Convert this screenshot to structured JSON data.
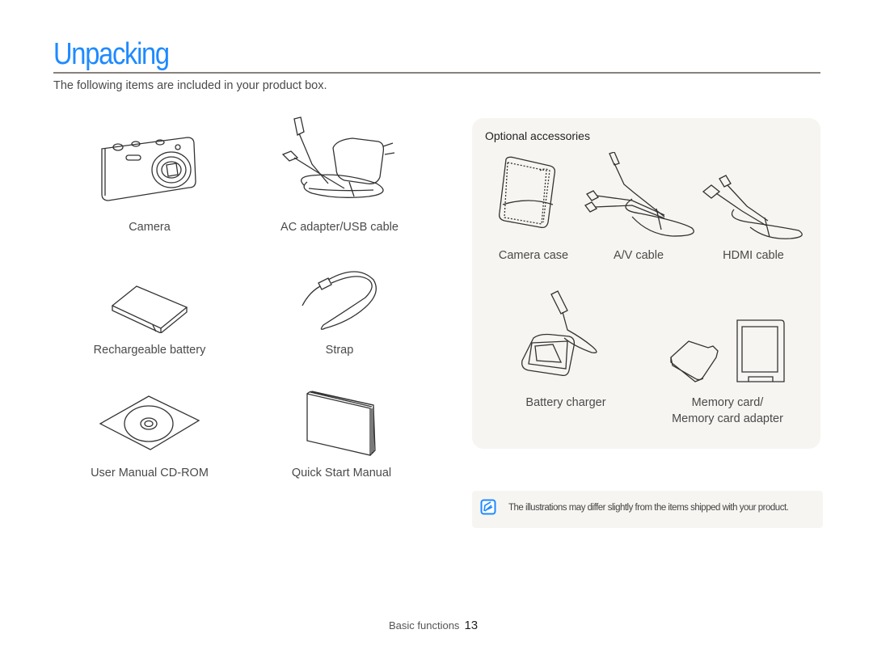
{
  "page": {
    "title": "Unpacking",
    "intro": "The following items are included in your product box."
  },
  "included_items": [
    {
      "label": "Camera",
      "icon": "camera-icon"
    },
    {
      "label": "AC adapter/USB cable",
      "icon": "ac-adapter-icon"
    },
    {
      "label": "Rechargeable battery",
      "icon": "battery-icon"
    },
    {
      "label": "Strap",
      "icon": "strap-icon"
    },
    {
      "label": "User Manual CD-ROM",
      "icon": "cd-rom-icon"
    },
    {
      "label": "Quick Start Manual",
      "icon": "manual-icon"
    }
  ],
  "optional": {
    "title": "Optional accessories",
    "items": [
      {
        "label": "Camera case",
        "icon": "camera-case-icon"
      },
      {
        "label": "A/V cable",
        "icon": "av-cable-icon"
      },
      {
        "label": "HDMI cable",
        "icon": "hdmi-cable-icon"
      },
      {
        "label": "Battery charger",
        "icon": "battery-charger-icon"
      },
      {
        "label": "Memory card/",
        "label2": "Memory card adapter",
        "icon": "memory-card-icon"
      }
    ]
  },
  "note": {
    "icon": "note-icon",
    "text": "The illustrations may differ slightly from the items shipped with your product."
  },
  "footer": {
    "section": "Basic functions",
    "page_number": "13"
  },
  "colors": {
    "accent": "#1e8aff",
    "rule": "#8b817c",
    "panel": "#f7f5f1"
  }
}
